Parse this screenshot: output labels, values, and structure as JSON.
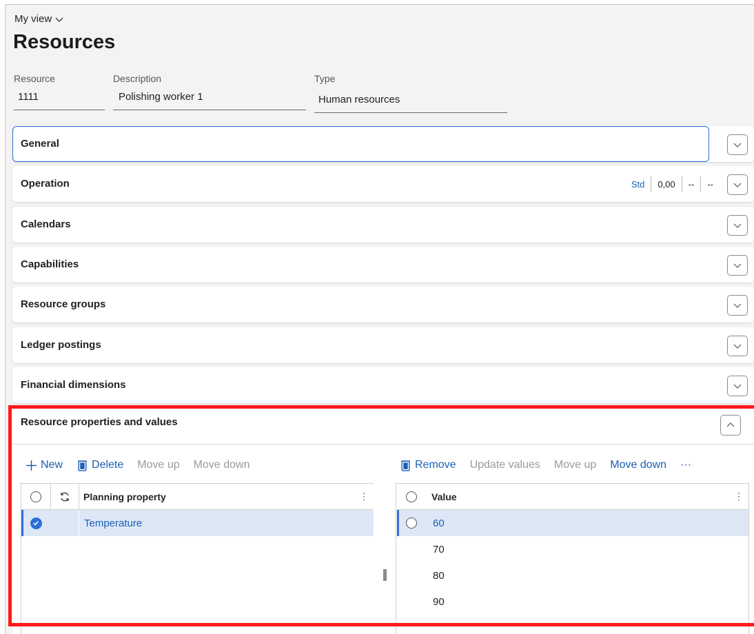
{
  "view": {
    "label": "My view"
  },
  "page": {
    "title": "Resources"
  },
  "header_fields": [
    {
      "label": "Resource",
      "value": "1111"
    },
    {
      "label": "Description",
      "value": "Polishing worker 1"
    },
    {
      "label": "Type",
      "value": "Human resources"
    }
  ],
  "fasttabs": {
    "general": "General",
    "operation": "Operation",
    "calendars": "Calendars",
    "capabilities": "Capabilities",
    "resource_groups": "Resource groups",
    "ledger_postings": "Ledger postings",
    "financial_dimensions": "Financial dimensions",
    "resource_properties": "Resource properties and values"
  },
  "operation_summary": {
    "std": "Std",
    "value": "0,00",
    "dash1": "--",
    "dash2": "--"
  },
  "properties_toolbar": {
    "new": "New",
    "delete": "Delete",
    "move_up": "Move up",
    "move_down": "Move down"
  },
  "values_toolbar": {
    "remove": "Remove",
    "update_values": "Update values",
    "move_up": "Move up",
    "move_down": "Move down",
    "more": "···"
  },
  "properties_grid": {
    "header": "Planning property",
    "rows": [
      "Temperature"
    ]
  },
  "values_grid": {
    "header": "Value",
    "rows": [
      "60",
      "70",
      "80",
      "90"
    ]
  },
  "colors": {
    "accent": "#2f6fd8",
    "link": "#1a5fb4",
    "highlight": "#ff1a1a",
    "selected_row": "#dde7f6"
  }
}
